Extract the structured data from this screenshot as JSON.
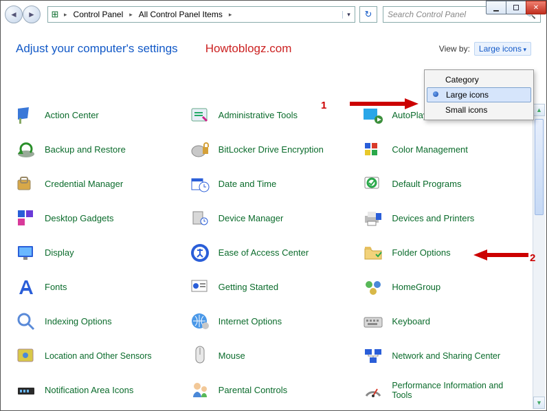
{
  "window": {
    "min_tip": "Minimize",
    "max_tip": "Maximize",
    "close_tip": "Close"
  },
  "nav": {
    "breadcrumb": [
      "Control Panel",
      "All Control Panel Items"
    ],
    "search_placeholder": "Search Control Panel"
  },
  "header": {
    "adjust": "Adjust your computer's settings",
    "watermark": "Howtoblogz.com",
    "viewby_label": "View by:",
    "viewby_value": "Large icons"
  },
  "view_menu": {
    "options": [
      "Category",
      "Large icons",
      "Small icons"
    ],
    "selected": "Large icons"
  },
  "items": [
    {
      "label": "Action Center",
      "icon": "action-center-icon"
    },
    {
      "label": "Administrative Tools",
      "icon": "admin-tools-icon"
    },
    {
      "label": "AutoPlay",
      "icon": "autoplay-icon"
    },
    {
      "label": "Backup and Restore",
      "icon": "backup-restore-icon"
    },
    {
      "label": "BitLocker Drive Encryption",
      "icon": "bitlocker-icon"
    },
    {
      "label": "Color Management",
      "icon": "color-mgmt-icon"
    },
    {
      "label": "Credential Manager",
      "icon": "credential-mgr-icon"
    },
    {
      "label": "Date and Time",
      "icon": "date-time-icon"
    },
    {
      "label": "Default Programs",
      "icon": "default-programs-icon"
    },
    {
      "label": "Desktop Gadgets",
      "icon": "desktop-gadgets-icon"
    },
    {
      "label": "Device Manager",
      "icon": "device-mgr-icon"
    },
    {
      "label": "Devices and Printers",
      "icon": "devices-printers-icon"
    },
    {
      "label": "Display",
      "icon": "display-icon"
    },
    {
      "label": "Ease of Access Center",
      "icon": "ease-access-icon"
    },
    {
      "label": "Folder Options",
      "icon": "folder-options-icon"
    },
    {
      "label": "Fonts",
      "icon": "fonts-icon"
    },
    {
      "label": "Getting Started",
      "icon": "getting-started-icon"
    },
    {
      "label": "HomeGroup",
      "icon": "homegroup-icon"
    },
    {
      "label": "Indexing Options",
      "icon": "indexing-icon"
    },
    {
      "label": "Internet Options",
      "icon": "internet-options-icon"
    },
    {
      "label": "Keyboard",
      "icon": "keyboard-icon"
    },
    {
      "label": "Location and Other Sensors",
      "icon": "location-sensors-icon",
      "two": true
    },
    {
      "label": "Mouse",
      "icon": "mouse-icon"
    },
    {
      "label": "Network and Sharing Center",
      "icon": "network-sharing-icon",
      "two": true
    },
    {
      "label": "Notification Area Icons",
      "icon": "notification-icons-icon"
    },
    {
      "label": "Parental Controls",
      "icon": "parental-controls-icon"
    },
    {
      "label": "Performance Information and Tools",
      "icon": "performance-info-icon",
      "two": true
    }
  ],
  "annotations": {
    "num1": "1",
    "num2": "2"
  },
  "colors": {
    "link_green": "#0a6b2b",
    "accent_blue": "#1259c7",
    "annotation_red": "#c00"
  }
}
